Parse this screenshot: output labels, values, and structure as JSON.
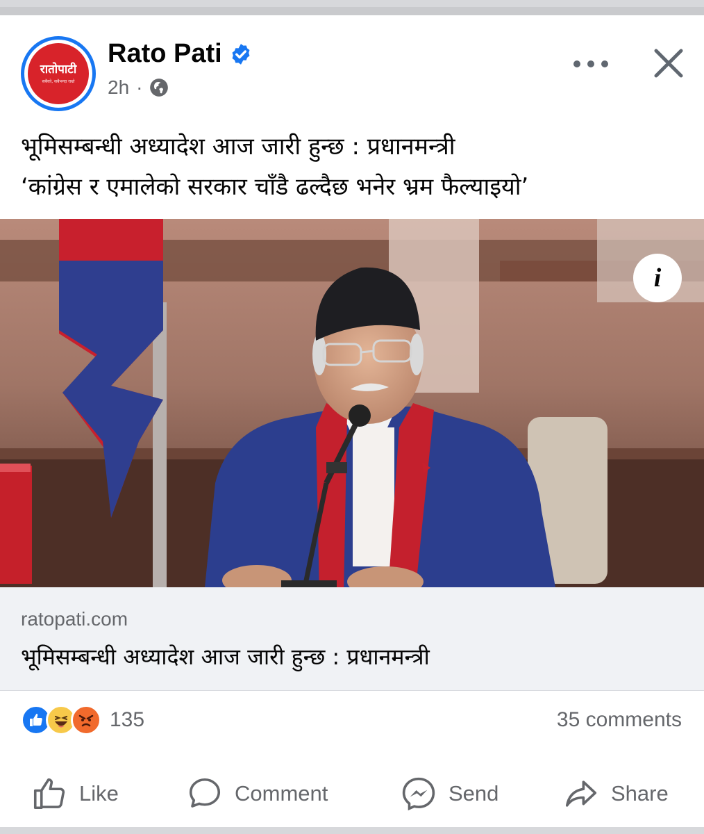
{
  "post": {
    "page_name": "Rato Pati",
    "avatar_logo_text": "रातोपाटी",
    "avatar_tagline": "सबैको, सबैभन्दा राम्रो",
    "time": "2h",
    "dot": "·",
    "privacy_icon": "globe-icon",
    "verified_icon": "verified-badge-icon",
    "caption_line1": "भूमिसम्बन्धी अध्यादेश आज जारी हुन्छ : प्रधानमन्त्री",
    "caption_line2": "‘कांग्रेस र एमालेको सरकार चाँडै ढल्दैछ भनेर भ्रम फैल्याइयो’",
    "info_label": "i"
  },
  "link": {
    "domain": "ratopati.com",
    "title": "भूमिसम्बन्धी अध्यादेश आज जारी हुन्छ : प्रधानमन्त्री"
  },
  "stats": {
    "reaction_icons": [
      "like-reaction-icon",
      "haha-reaction-icon",
      "angry-reaction-icon"
    ],
    "reaction_count": "135",
    "comments": "35 comments"
  },
  "actions": {
    "like": "Like",
    "comment": "Comment",
    "send": "Send",
    "share": "Share"
  },
  "colors": {
    "facebook_blue": "#1877f2",
    "brand_red": "#d8232a",
    "secondary_text": "#65676b"
  }
}
